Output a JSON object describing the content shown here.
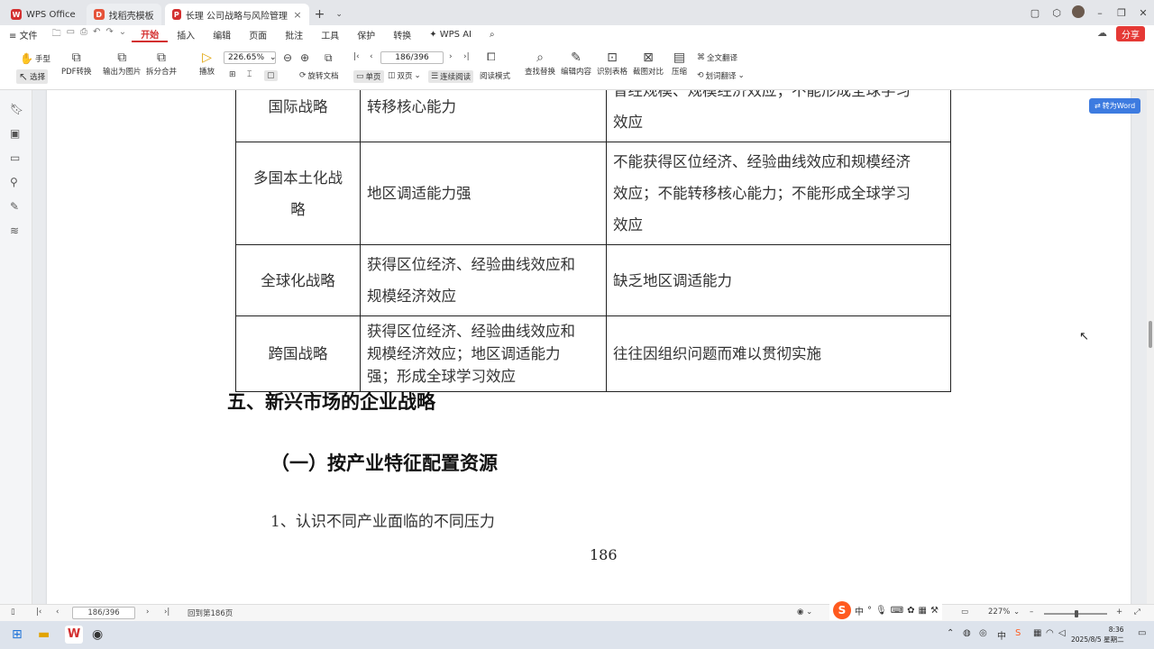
{
  "titlebar": {
    "tabs": [
      {
        "label": "WPS Office",
        "color": "#d32f2f"
      },
      {
        "label": "找稻壳模板",
        "color": "#e5533a"
      },
      {
        "label": "长理   公司战略与风险管理颁…",
        "color": "#d32f2f"
      }
    ]
  },
  "menu": {
    "file": "文件",
    "items": [
      "开始",
      "插入",
      "编辑",
      "页面",
      "批注",
      "工具",
      "保护",
      "转换",
      "WPS AI"
    ],
    "share": "分享"
  },
  "ribbon": {
    "hand": "手型",
    "select": "选择",
    "pdf_convert": "PDF转换",
    "export_image": "输出为图片",
    "split_merge": "拆分合并",
    "play": "播放",
    "zoom": "226.65%",
    "page": "186/396",
    "rotate": "旋转文档",
    "single": "单页",
    "double": "双页",
    "continuous": "连续阅读",
    "read_mode": "阅读模式",
    "find_replace": "查找替换",
    "edit_content": "编辑内容",
    "recognize_table": "识别表格",
    "screenshot_compare": "截图对比",
    "compress": "压缩",
    "full_translate": "全文翻译",
    "word_translate": "划词翻译"
  },
  "to_word": "转为Word",
  "table": {
    "rows": [
      {
        "name": "国际战略",
        "adv": "转移核心能力",
        "dis": [
          "曾经规模、规模经济效应；不能形成全球学习",
          "效应"
        ]
      },
      {
        "name": [
          "多国本土化战",
          "略"
        ],
        "adv": "地区调适能力强",
        "dis": [
          "不能获得区位经济、经验曲线效应和规模经济",
          "效应；不能转移核心能力；不能形成全球学习",
          "效应"
        ]
      },
      {
        "name": "全球化战略",
        "adv": [
          "获得区位经济、经验曲线效应和",
          "规模经济效应"
        ],
        "dis": "缺乏地区调适能力"
      },
      {
        "name": "跨国战略",
        "adv": [
          "获得区位经济、经验曲线效应和",
          "规模经济效应；地区调适能力",
          "强；形成全球学习效应"
        ],
        "dis": "往往因组织问题而难以贯彻实施"
      }
    ]
  },
  "doc": {
    "heading": "五、新兴市场的企业战略",
    "subheading": "（一）按产业特征配置资源",
    "para": "1、认识不同产业面临的不同压力",
    "page_number": "186"
  },
  "status": {
    "page": "186/396",
    "goto": "回到第186页",
    "zoom": "227%"
  },
  "ime": {
    "logo": "S",
    "items": [
      "中",
      "°"
    ]
  },
  "clock": {
    "time": "8:36",
    "date": "2025/8/5 星期二"
  }
}
